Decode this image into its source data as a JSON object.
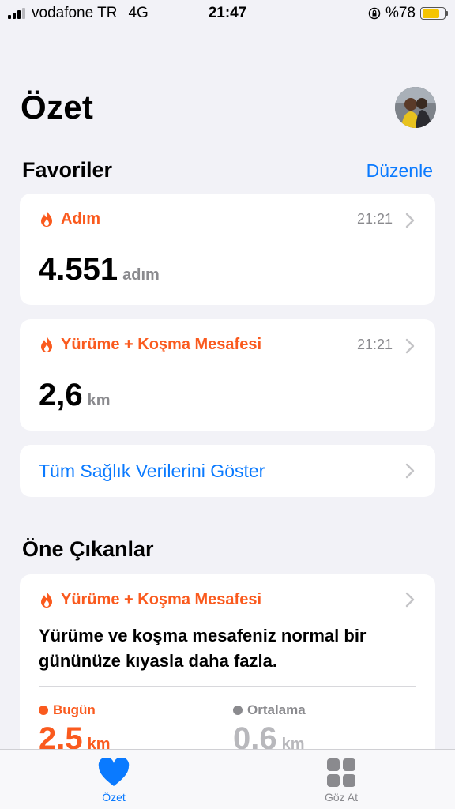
{
  "status_bar": {
    "carrier": "vodafone TR",
    "network": "4G",
    "time": "21:47",
    "battery_text": "%78",
    "battery_level": 0.78,
    "battery_color": "#f5c400"
  },
  "header": {
    "title": "Özet",
    "avatar_icon": "profile-photo"
  },
  "favorites": {
    "title": "Favoriler",
    "edit_label": "Düzenle",
    "items": [
      {
        "label": "Adım",
        "time": "21:21",
        "value": "4.551",
        "unit": "adım",
        "icon": "flame-icon"
      },
      {
        "label": "Yürüme + Koşma Mesafesi",
        "time": "21:21",
        "value": "2,6",
        "unit": "km",
        "icon": "flame-icon"
      }
    ],
    "show_all_label": "Tüm Sağlık Verilerini Göster"
  },
  "highlights": {
    "title": "Öne Çıkanlar",
    "card": {
      "label": "Yürüme + Koşma Mesafesi",
      "description": "Yürüme ve koşma mesafeniz normal bir gününüze kıyasla daha fazla.",
      "today_label": "Bugün",
      "today_value": "2.5",
      "today_unit": "km",
      "average_label": "Ortalama",
      "average_value": "0.6",
      "average_unit": "km"
    }
  },
  "tabbar": {
    "tabs": [
      {
        "label": "Özet",
        "icon": "heart-icon",
        "active": true
      },
      {
        "label": "Göz At",
        "icon": "grid-icon",
        "active": false
      }
    ]
  },
  "colors": {
    "accent": "#0a7aff",
    "orange": "#fa5a1e",
    "gray": "#8a8a8e",
    "background": "#f2f2f7"
  }
}
